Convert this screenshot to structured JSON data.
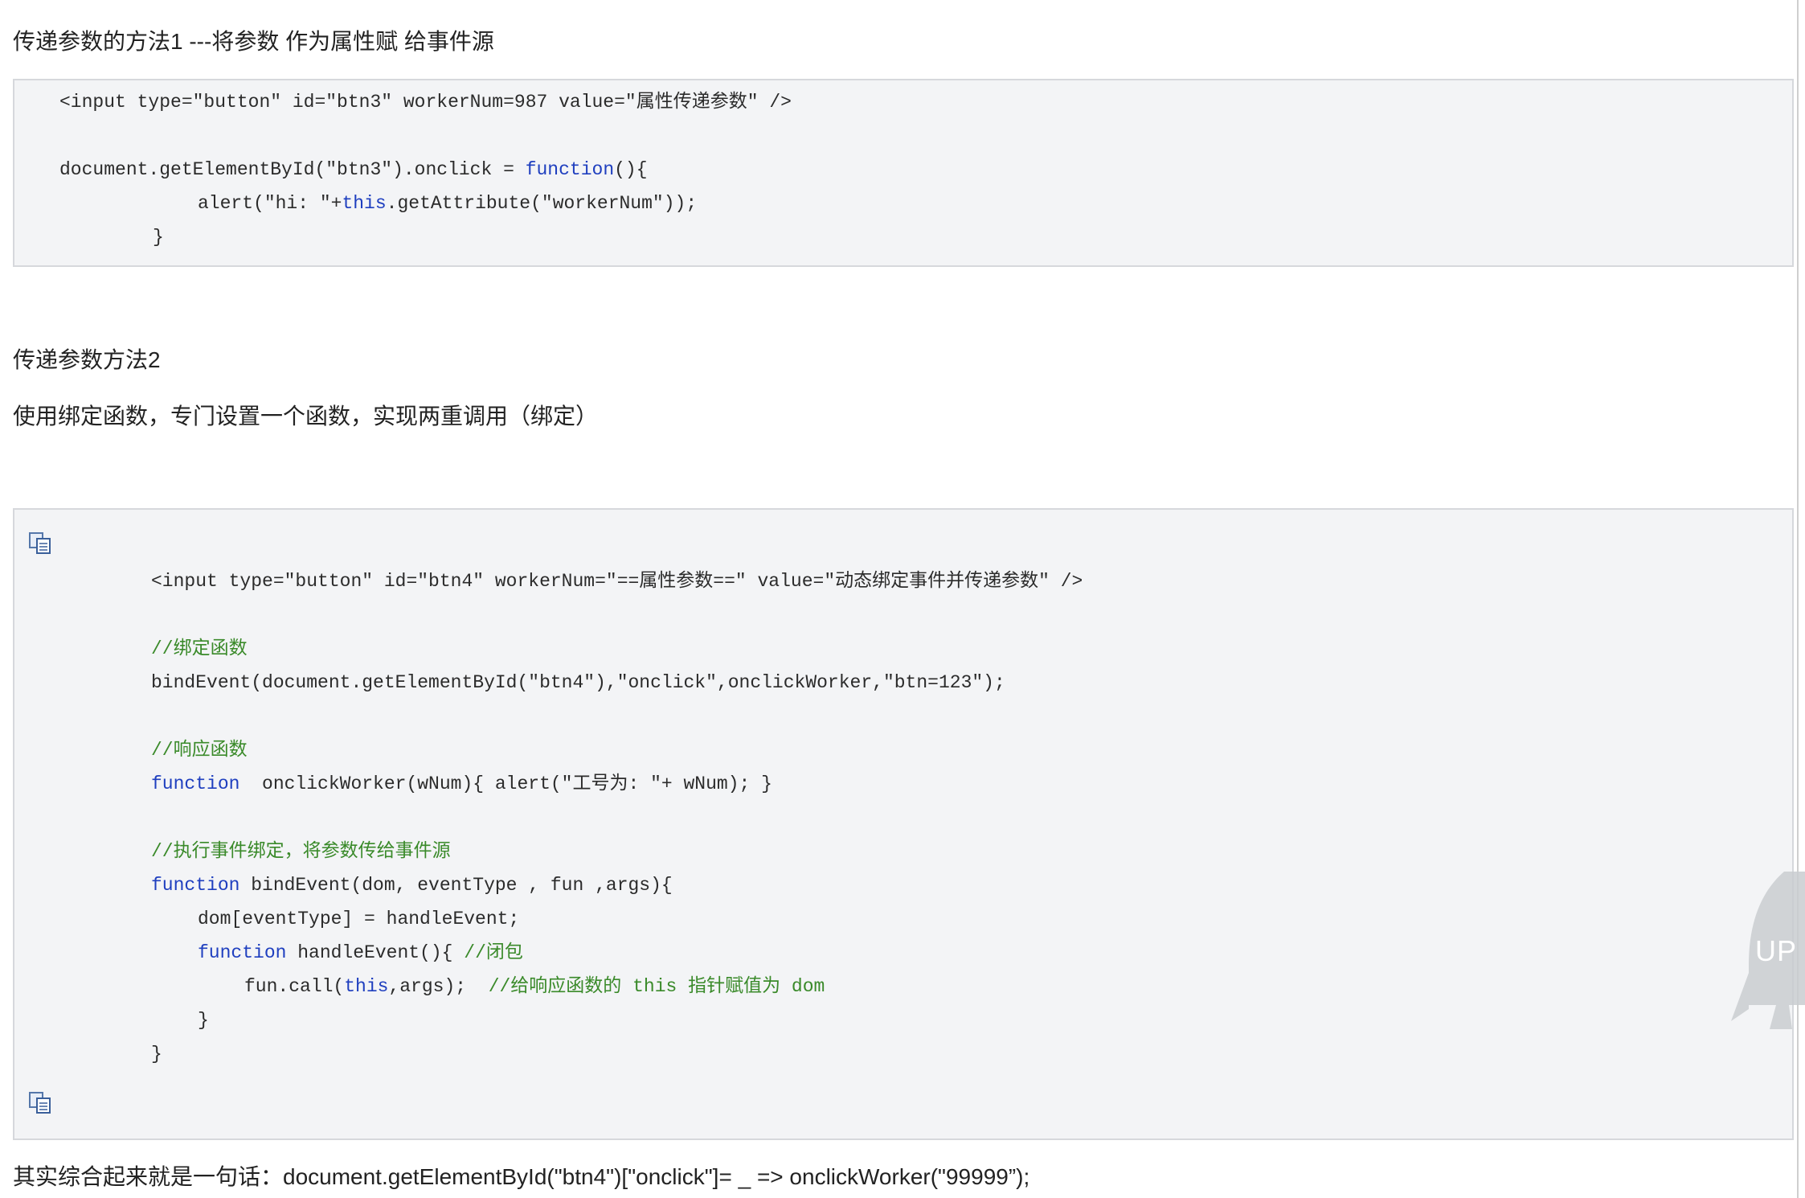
{
  "section1": {
    "heading": "传递参数的方法1 ---将参数 作为属性赋 给事件源",
    "code": {
      "line1": "<input type=\"button\" id=\"btn3\" workerNum=987 value=\"属性传递参数\" />",
      "line2_pre": "document.getElementById(\"btn3\").onclick = ",
      "line2_kw": "function",
      "line2_post": "(){",
      "line3_pre": "alert(\"hi: \"+",
      "line3_kw": "this",
      "line3_post": ".getAttribute(\"workerNum\"));",
      "line4": "}"
    }
  },
  "section2": {
    "heading": "传递参数方法2",
    "description": "使用绑定函数，专门设置一个函数，实现两重调用（绑定）",
    "code": {
      "line1": "<input type=\"button\" id=\"btn4\" workerNum=\"==属性参数==\" value=\"动态绑定事件并传递参数\" />",
      "comment1": "//绑定函数",
      "line2": "bindEvent(document.getElementById(\"btn4\"),\"onclick\",onclickWorker,\"btn=123\");",
      "comment2": "//响应函数",
      "line3_kw": "function",
      "line3_post": "  onclickWorker(wNum){ alert(\"工号为: \"+ wNum); }",
      "comment3": "//执行事件绑定，将参数传给事件源",
      "line4_kw": "function",
      "line4_post": " bindEvent(dom, eventType , fun ,args){",
      "line5": "dom[eventType] = handleEvent;",
      "line6_kw": "function",
      "line6_post": " handleEvent(){ ",
      "line6_comment": "//闭包",
      "line7_pre": "fun.call(",
      "line7_kw": "this",
      "line7_post": ",args);  ",
      "line7_comment": "//给响应函数的 this 指针赋值为 dom",
      "line8": "}",
      "line9": "}"
    },
    "copy_icon_top": "copy-code-icon",
    "copy_icon_bottom": "copy-code-icon"
  },
  "summary": "其实综合起来就是一句话：document.getElementById(\"btn4\")[\"onclick\"]= _ => onclickWorker(\"99999”);",
  "back_to_top": {
    "label": "UP",
    "icon": "rocket-icon"
  },
  "colors": {
    "keyword": "#1f3fbf",
    "comment": "#3a8a2a",
    "code_bg": "#f3f4f6",
    "code_border": "#d6d8dc"
  }
}
